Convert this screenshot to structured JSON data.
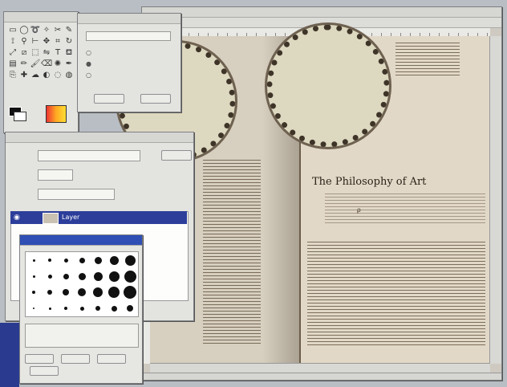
{
  "document": {
    "title": "The Philosophy of Art",
    "formula": "ρ"
  },
  "layers_panel": {
    "layer_name": "Layer"
  },
  "colors": {
    "foreground": "#111111",
    "background": "#ffffff",
    "selection": "#2c3e9a",
    "brushes_title": "#2f4fb4"
  },
  "toolbox": {
    "tools": [
      "rect-select-icon",
      "ellipse-select-icon",
      "lasso-icon",
      "magic-wand-icon",
      "scissors-icon",
      "paths-icon",
      "color-picker-icon",
      "zoom-icon",
      "measure-icon",
      "move-icon",
      "crop-icon",
      "rotate-icon",
      "scale-icon",
      "shear-icon",
      "perspective-icon",
      "flip-icon",
      "text-icon",
      "bucket-fill-icon",
      "blend-icon",
      "pencil-icon",
      "paintbrush-icon",
      "eraser-icon",
      "airbrush-icon",
      "ink-icon",
      "clone-icon",
      "heal-icon",
      "smudge-icon",
      "dodge-burn-icon",
      "convolve-icon",
      "foreground-select-icon"
    ]
  }
}
